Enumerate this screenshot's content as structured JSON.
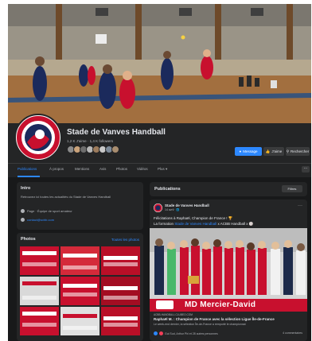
{
  "page": {
    "name": "Stade de Vanves Handball",
    "stats": "1,2 K J'aime · 1,4 K followers"
  },
  "actions": {
    "message": "Message",
    "like": "J'aime",
    "search": "Rechercher"
  },
  "tabs": [
    "Publications",
    "À propos",
    "Mentions",
    "Avis",
    "Photos",
    "Vidéos",
    "Plus ▾"
  ],
  "intro": {
    "title": "Intro",
    "description": "Retrouvez ici toutes les actualités du Stade de Vanves Handball",
    "category": "Page · Équipe de sport amateur",
    "email": "contact@svhb.com"
  },
  "photos": {
    "title": "Photos",
    "see_all": "Toutes les photos",
    "tiles": [
      {
        "color": "#c8102e"
      },
      {
        "color": "#d42a3a"
      },
      {
        "color": "#b90f27"
      },
      {
        "color": "#d9d9d9"
      },
      {
        "color": "#c8102e"
      },
      {
        "color": "#a30d22"
      },
      {
        "color": "#c8102e"
      },
      {
        "color": "#e0e0e0"
      },
      {
        "color": "#b90f27"
      }
    ]
  },
  "feed": {
    "title": "Publications",
    "filters": "Filtres"
  },
  "post": {
    "author": "Stade de Vanves Handball",
    "time": "14 avril · 🌐",
    "text_line1": "Félicitations à Raphaël, Champion de France ! 🏆",
    "text_prefix": "La formation ",
    "text_mention": "Stade de Vanves Handball",
    "text_suffix": " x ACBB Handball x 🏐",
    "sponsor": "MD Mercier-David",
    "link_source": "ACBB-HANDBALL.CLUBEO.COM",
    "link_title": "Raphaël M. : Champion de France avec la sélection Ligue Île-de-France",
    "link_desc": "Le week-end dernier, la sélection Île-de-France a remporté le championnat",
    "reactions": "Gui Sud, Arthur Phi et 28 autres personnes",
    "comments": "4 commentaires"
  },
  "colors": {
    "background": "#18191a",
    "card": "#242526",
    "accent": "#2d88ff",
    "club_red": "#c8102e"
  }
}
